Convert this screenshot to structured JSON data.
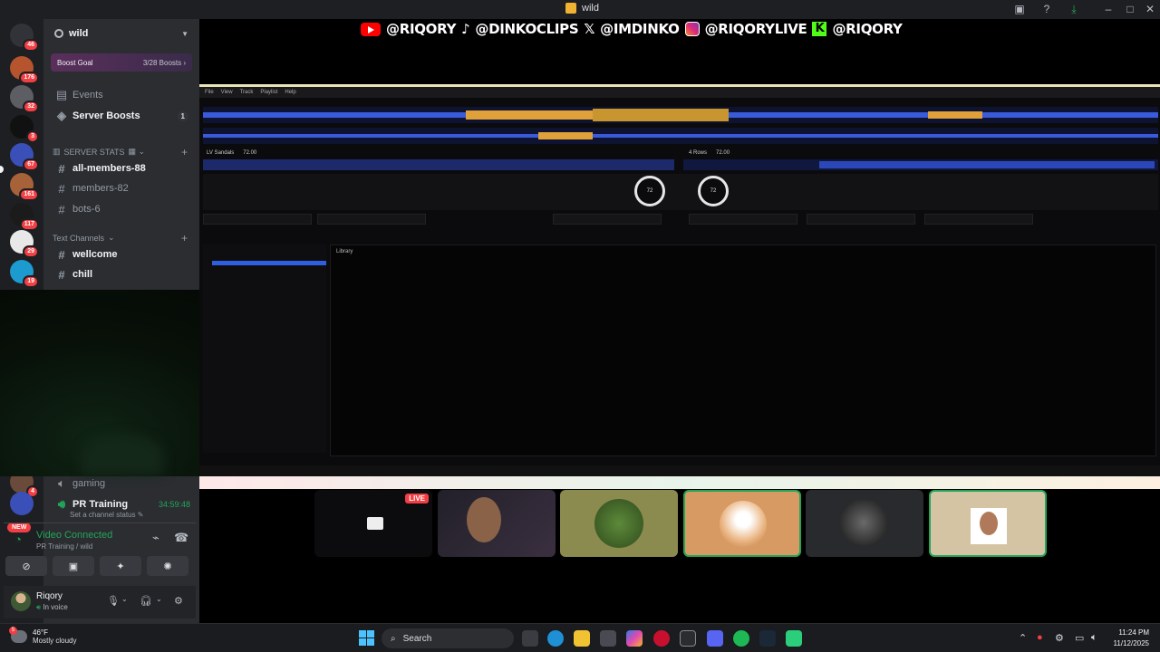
{
  "window": {
    "title": "wild"
  },
  "servers": [
    {
      "badge": "46"
    },
    {
      "badge": "176"
    },
    {
      "badge": "32"
    },
    {
      "badge": "3"
    },
    {
      "badge": "67"
    },
    {
      "badge": "161"
    },
    {
      "badge": "117"
    },
    {
      "badge": "29"
    },
    {
      "badge": "19"
    },
    {
      "badge": "4"
    }
  ],
  "new_badge": "NEW",
  "sidebar": {
    "server_name": "wild",
    "boost_goal": {
      "label": "Boost Goal",
      "count": "3/28 Boosts"
    },
    "events": "Events",
    "server_boosts": {
      "label": "Server Boosts",
      "count": "1"
    },
    "server_stats_category": "SERVER STATS",
    "stat_channels": [
      "all-members-88",
      "members-82",
      "bots-6"
    ],
    "text_category": "Text Channels",
    "text_channels": [
      "wellcome",
      "chill"
    ],
    "voice_channels": [
      {
        "name": "gaming"
      },
      {
        "name": "PR Training",
        "timer": "34:59:48",
        "status": "Set a channel status"
      }
    ]
  },
  "voice_status": {
    "title": "Video Connected",
    "sub": "PR Training / wild"
  },
  "user": {
    "name": "Riqory",
    "status": "In voice"
  },
  "overlay": {
    "handles": [
      "@RIQORY",
      "@DINKOCLIPS",
      "@IMDINKO",
      "@RIQORYLIVE",
      "@RIQORY"
    ]
  },
  "dj": {
    "menu": [
      "File",
      "View",
      "Track",
      "Playlist",
      "Help"
    ],
    "deck_a": {
      "title": "LV Sandals",
      "bpm": "72.00"
    },
    "deck_b": {
      "title": "4 Rows",
      "bpm": "72.00"
    },
    "browser_title": "Library",
    "colors": {
      "wave_blue": "#3a5bd9",
      "wave_orange": "#e0a03a"
    }
  },
  "participants": [
    {
      "live": "LIVE"
    },
    {},
    {},
    {},
    {},
    {}
  ],
  "taskbar": {
    "temp": "46°F",
    "weather": "Mostly cloudy",
    "weather_badge": "5",
    "search_placeholder": "Search",
    "time": "11:24 PM",
    "date": "11/12/2025"
  }
}
